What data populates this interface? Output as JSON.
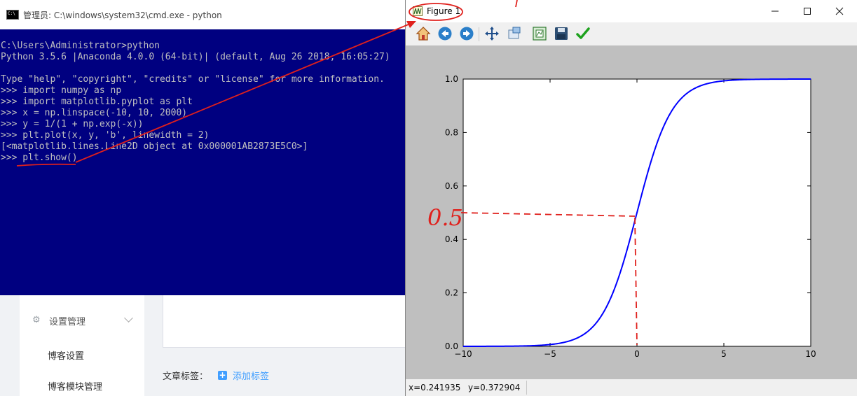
{
  "background_page": {
    "menu_group_label": "设置管理",
    "menu_items": [
      "博客设置",
      "博客模块管理"
    ],
    "tags_label": "文章标签：",
    "add_tag_label": "添加标签"
  },
  "cmd": {
    "title": "管理员: C:\\windows\\system32\\cmd.exe - python",
    "lines": [
      "C:\\Users\\Administrator>python",
      "Python 3.5.6 |Anaconda 4.0.0 (64-bit)| (default, Aug 26 2018, 16:05:27)",
      "",
      "Type \"help\", \"copyright\", \"credits\" or \"license\" for more information.",
      ">>> import numpy as np",
      ">>> import matplotlib.pyplot as plt",
      ">>> x = np.linspace(-10, 10, 2000)",
      ">>> y = 1/(1 + np.exp(-x))",
      ">>> plt.plot(x, y, 'b', linewidth = 2)",
      "[<matplotlib.lines.Line2D object at 0x000001AB2873E5C0>]",
      ">>> plt.show()"
    ]
  },
  "figure": {
    "title": "Figure 1",
    "toolbar": [
      "home-icon",
      "back-arrow-icon",
      "forward-arrow-icon",
      "pan-icon",
      "zoom-icon",
      "subplots-icon",
      "save-icon",
      "edit-checkmark-icon"
    ],
    "status_x": "x=0.241935",
    "status_y": "y=0.372904",
    "annotation": "0.5"
  },
  "chart_data": {
    "type": "line",
    "function": "1/(1+exp(-x))",
    "xlim": [
      -10,
      10
    ],
    "ylim": [
      0,
      1
    ],
    "xticks": [
      -10,
      -5,
      0,
      5,
      10
    ],
    "yticks": [
      0.0,
      0.2,
      0.4,
      0.6,
      0.8,
      1.0
    ],
    "xtick_labels": [
      "−10",
      "−5",
      "0",
      "5",
      "10"
    ],
    "ytick_labels": [
      "0.0",
      "0.2",
      "0.4",
      "0.6",
      "0.8",
      "1.0"
    ],
    "series": [
      {
        "color": "#0000ff",
        "linewidth": 2,
        "x_range": [
          -10,
          10
        ],
        "n_points": 2000
      }
    ],
    "grid": false,
    "colors": {
      "line": "#0000ff",
      "panel_bg": "#bfbfbf",
      "axes_bg": "#ffffff",
      "annotation": "#e0201c"
    }
  }
}
